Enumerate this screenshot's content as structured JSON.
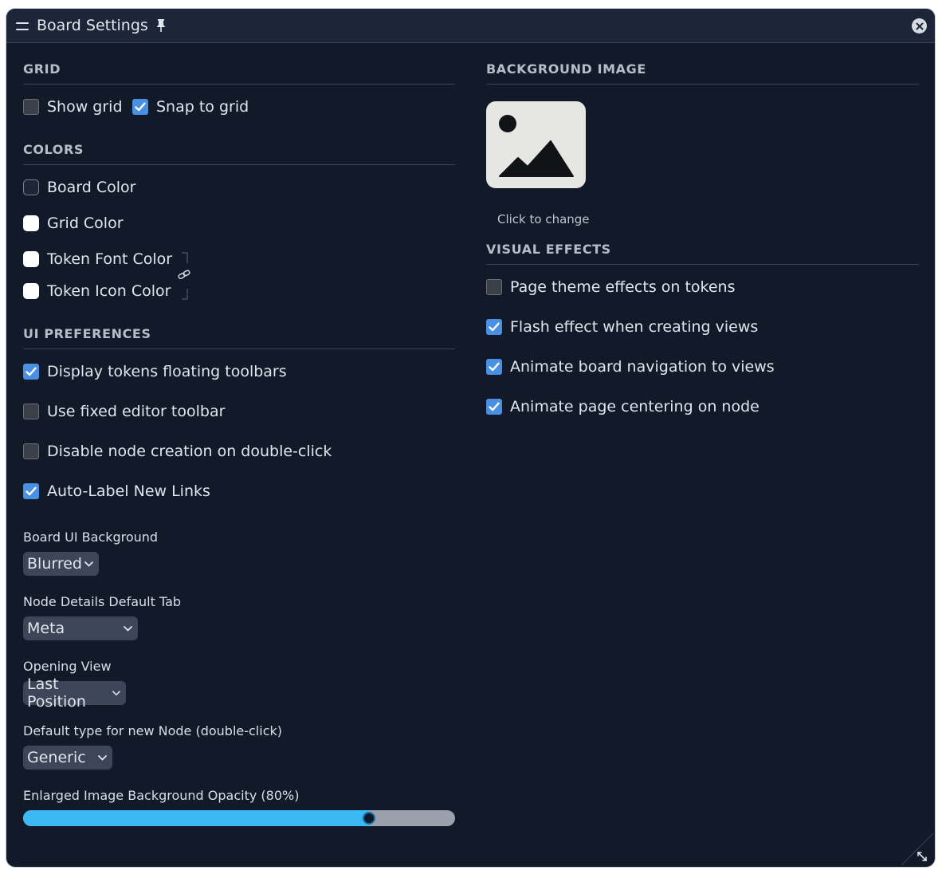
{
  "window": {
    "title": "Board Settings"
  },
  "grid": {
    "title": "GRID",
    "show_grid": {
      "label": "Show grid",
      "checked": false
    },
    "snap_to_grid": {
      "label": "Snap to grid",
      "checked": true
    }
  },
  "colors": {
    "title": "COLORS",
    "board_color": "Board Color",
    "grid_color": "Grid Color",
    "token_font_color": "Token Font Color",
    "token_icon_color": "Token Icon Color"
  },
  "ui_preferences": {
    "title": "UI PREFERENCES",
    "options": [
      {
        "label": "Display tokens floating toolbars",
        "checked": true
      },
      {
        "label": "Use fixed editor toolbar",
        "checked": false
      },
      {
        "label": "Disable node creation on double-click",
        "checked": false
      },
      {
        "label": "Auto-Label New Links",
        "checked": true
      }
    ],
    "board_ui_background": {
      "label": "Board UI Background",
      "value": "Blurred"
    },
    "node_details_default_tab": {
      "label": "Node Details Default Tab",
      "value": "Meta"
    },
    "opening_view": {
      "label": "Opening View",
      "value": "Last Position"
    },
    "default_node_type": {
      "label": "Default type for new Node (double-click)",
      "value": "Generic"
    },
    "image_bg_opacity": {
      "label": "Enlarged Image Background Opacity (80%)",
      "value": 0.8
    }
  },
  "background_image": {
    "title": "BACKGROUND IMAGE",
    "caption": "Click to change"
  },
  "visual_effects": {
    "title": "VISUAL EFFECTS",
    "options": [
      {
        "label": "Page theme effects on tokens",
        "checked": false
      },
      {
        "label": "Flash effect when creating views",
        "checked": true
      },
      {
        "label": "Animate board navigation to views",
        "checked": true
      },
      {
        "label": "Animate page centering on node",
        "checked": true
      }
    ]
  },
  "colors_palette": {
    "accent": "#4a90e2",
    "slider_fill": "#3cb8f4",
    "window_bg": "#121a2a"
  }
}
